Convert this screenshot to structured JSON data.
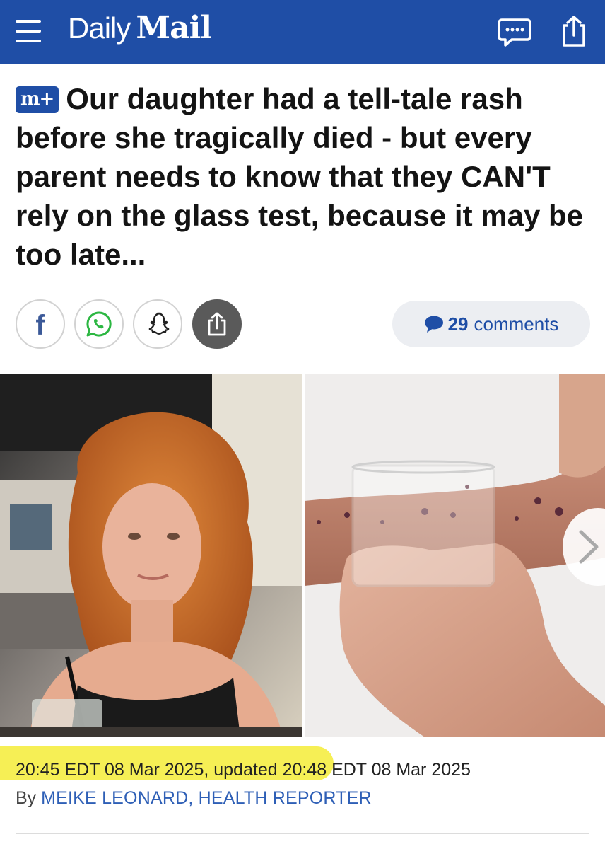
{
  "header": {
    "logo_daily": "Daily",
    "logo_mail": "Mail",
    "brand_color": "#1f4ea6"
  },
  "article": {
    "badge": "m+",
    "headline": "Our daughter had a tell-tale rash before she tragically died - but every parent needs to know that they CAN'T rely on the glass test, because it may be too late...",
    "comments_count": "29",
    "comments_label": "comments",
    "timestamp": "20:45 EDT 08 Mar 2025, updated 20:48 EDT 08 Mar 2025",
    "byline_prefix": "By",
    "author": "MEIKE LEONARD, HEALTH REPORTER",
    "highlight_color": "#f6ef55"
  },
  "share": {
    "icons": [
      "facebook-icon",
      "whatsapp-icon",
      "snapchat-icon",
      "share-icon"
    ]
  }
}
